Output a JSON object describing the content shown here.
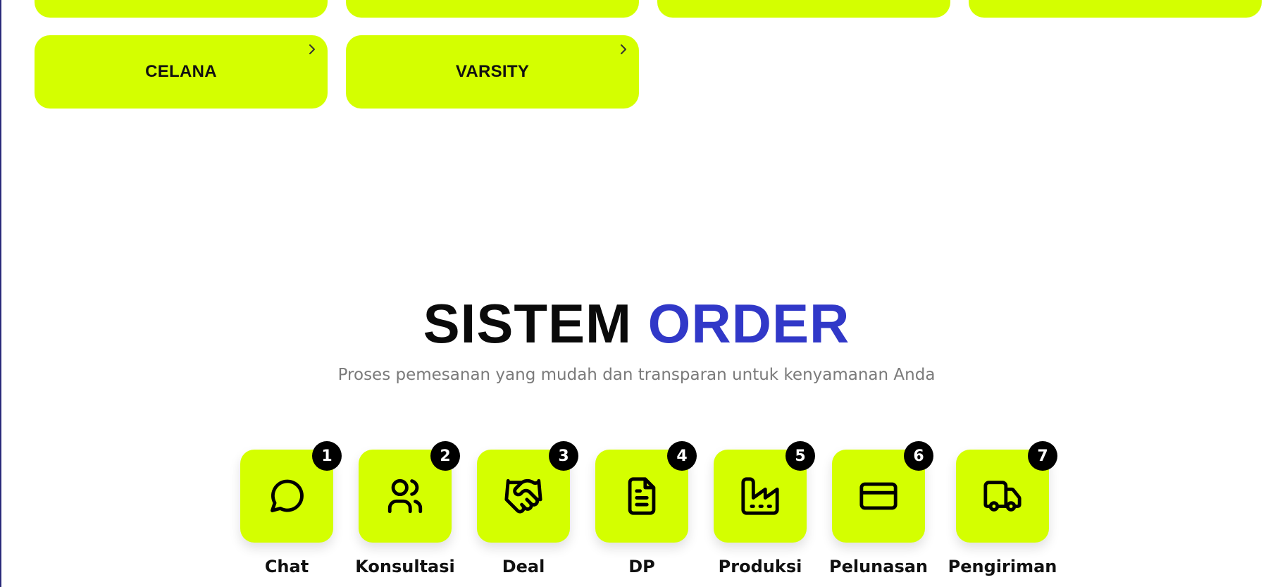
{
  "categories": {
    "partial_row": [
      "",
      "",
      "",
      ""
    ],
    "items": [
      {
        "label": "CELANA"
      },
      {
        "label": "VARSITY"
      }
    ]
  },
  "section": {
    "title_part1": "SISTEM",
    "title_part2": "ORDER",
    "subtitle": "Proses pemesanan yang mudah dan transparan untuk kenyamanan Anda"
  },
  "steps": [
    {
      "number": "1",
      "label": "Chat",
      "icon": "chat-bubble-icon"
    },
    {
      "number": "2",
      "label": "Konsultasi",
      "icon": "users-icon"
    },
    {
      "number": "3",
      "label": "Deal",
      "icon": "handshake-icon"
    },
    {
      "number": "4",
      "label": "DP",
      "icon": "document-icon"
    },
    {
      "number": "5",
      "label": "Produksi",
      "icon": "factory-icon"
    },
    {
      "number": "6",
      "label": "Pelunasan",
      "icon": "credit-card-icon"
    },
    {
      "number": "7",
      "label": "Pengiriman",
      "icon": "truck-icon"
    }
  ],
  "colors": {
    "accent": "#d4ff00",
    "title_highlight": "#3138c8",
    "badge": "#000000"
  }
}
